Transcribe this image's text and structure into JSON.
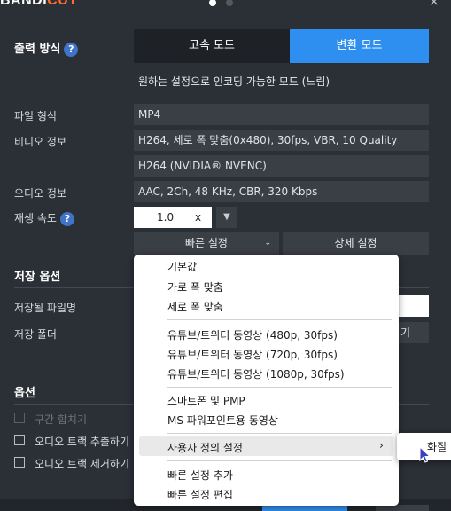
{
  "app": {
    "logo_main": "BANDI",
    "logo_accent": "CUT",
    "close": "×"
  },
  "output": {
    "label": "출력 방식",
    "help": "?",
    "fast_mode": "고속 모드",
    "convert_mode": "변환 모드",
    "description": "원하는 설정으로 인코딩 가능한 모드 (느림)"
  },
  "fields": {
    "format_label": "파일 형식",
    "format_value": "MP4",
    "video_label": "비디오 정보",
    "video_value": "H264, 세로 폭 맞춤(0x480), 30fps, VBR, 10 Quality",
    "encoder_value": "H264 (NVIDIA® NVENC)",
    "audio_label": "오디오 정보",
    "audio_value": "AAC, 2Ch, 48 KHz, CBR, 320 Kbps",
    "speed_label": "재생 속도",
    "speed_help": "?",
    "speed_value": "1.0",
    "speed_unit": "x"
  },
  "buttons": {
    "quick_settings": "빠른 설정",
    "detail_settings": "상세 설정",
    "browse_partial": "기"
  },
  "save": {
    "section": "저장 옵션",
    "filename_label": "저장될 파일명",
    "folder_label": "저장 폴더"
  },
  "options": {
    "section": "옵션",
    "merge": "구간 합치기",
    "extract_audio": "오디오 트랙 추출하기",
    "remove_audio": "오디오 트랙 제거하기"
  },
  "menu": {
    "items": [
      "기본값",
      "가로 폭 맞춤",
      "세로 폭 맞춤",
      "유튜브/트위터 동영상 (480p, 30fps)",
      "유튜브/트위터 동영상 (720p, 30fps)",
      "유튜브/트위터 동영상 (1080p, 30fps)",
      "스마트폰 및 PMP",
      "MS 파워포인트용 동영상",
      "사용자 정의 설정",
      "빠른 설정 추가",
      "빠른 설정 편집"
    ],
    "submenu_arrow": "›",
    "submenu_item": "화질"
  },
  "colors": {
    "accent": "#2f8ff0",
    "background": "#2b2f36",
    "field": "#3a3e45"
  }
}
